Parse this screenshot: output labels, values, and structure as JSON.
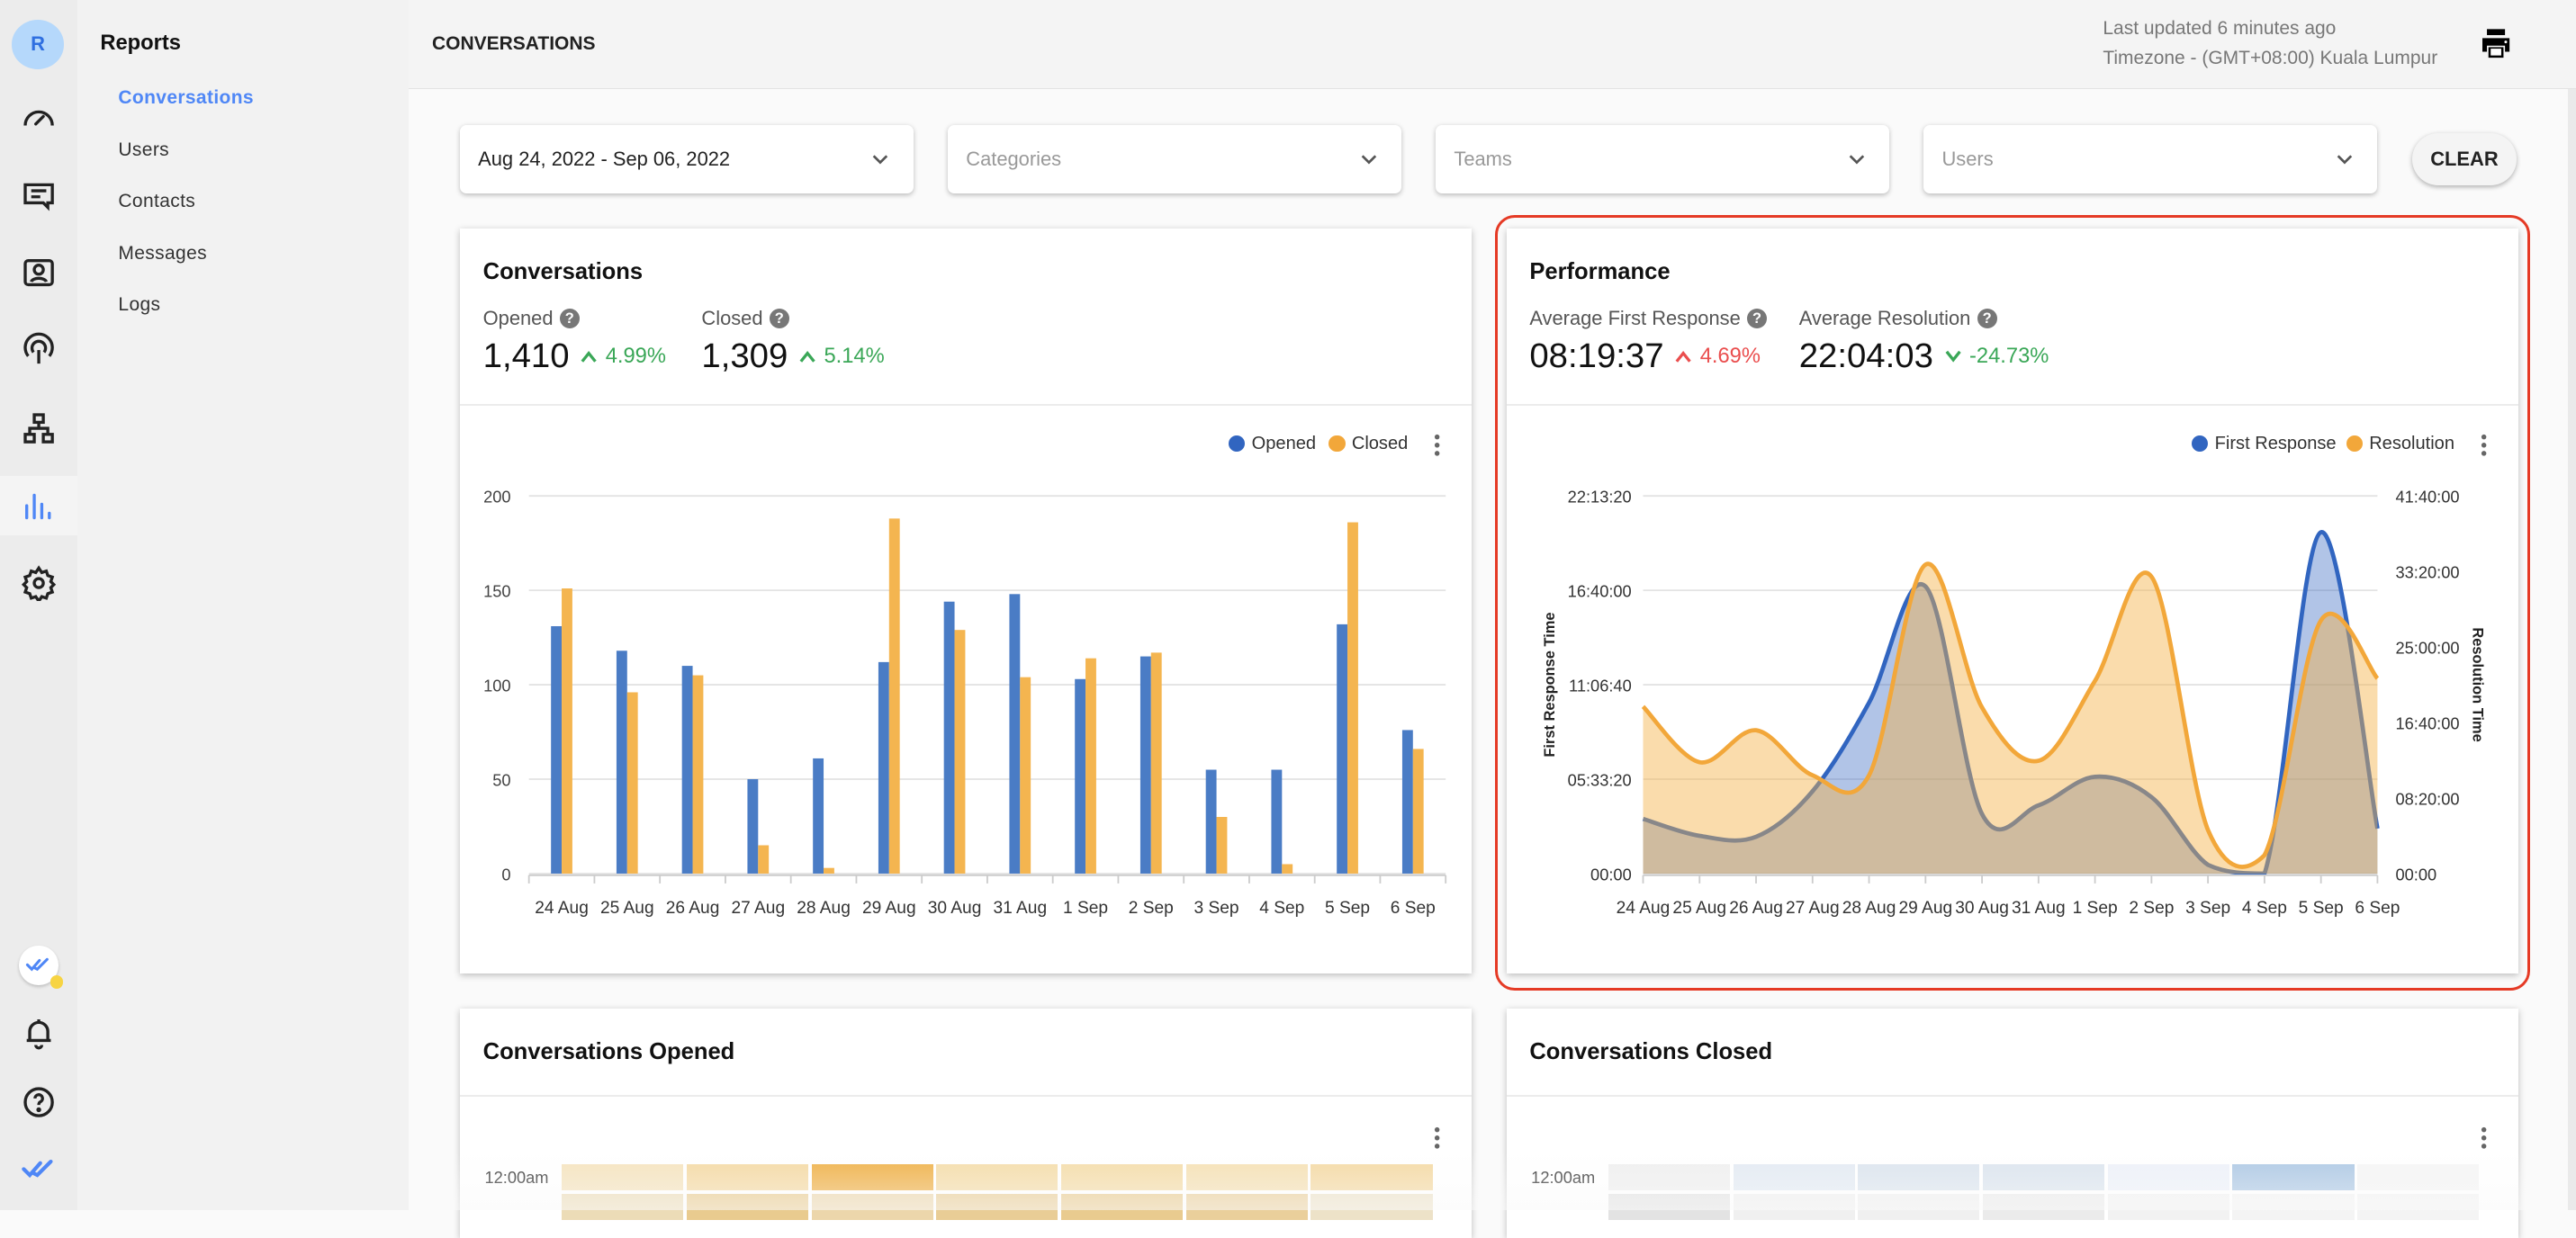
{
  "rail": {
    "avatar_initial": "R",
    "icons": [
      "gauge-icon",
      "chat-icon",
      "contact-icon",
      "broadcast-icon",
      "sitemap-icon",
      "bar-chart-icon",
      "gear-icon"
    ],
    "bottom_icons": [
      "app-badge-icon",
      "bell-icon",
      "help-icon",
      "logo-icon"
    ],
    "active": "bar-chart-icon",
    "accent": "#4f87f6"
  },
  "subnav": {
    "title": "Reports",
    "items": [
      {
        "label": "Conversations",
        "active": true
      },
      {
        "label": "Users"
      },
      {
        "label": "Contacts"
      },
      {
        "label": "Messages"
      },
      {
        "label": "Logs"
      }
    ]
  },
  "header": {
    "title": "CONVERSATIONS",
    "last_updated": "Last updated 6 minutes ago",
    "timezone": "Timezone - (GMT+08:00) Kuala Lumpur",
    "print_icon": "printer-icon"
  },
  "filters": {
    "date_range": "Aug 24, 2022 - Sep 06, 2022",
    "categories_placeholder": "Categories",
    "teams_placeholder": "Teams",
    "users_placeholder": "Users",
    "clear_label": "CLEAR"
  },
  "conversations_card": {
    "title": "Conversations",
    "opened_label": "Opened",
    "opened_value": "1,410",
    "opened_change": "4.99%",
    "closed_label": "Closed",
    "closed_value": "1,309",
    "closed_change": "5.14%",
    "up_color": "#3aa757"
  },
  "performance_card": {
    "title": "Performance",
    "afr_label": "Average First Response",
    "afr_value": "08:19:37",
    "afr_change": "4.69%",
    "afr_color": "#ea4e4e",
    "ar_label": "Average Resolution",
    "ar_value": "22:04:03",
    "ar_change": "-24.73%",
    "ar_color": "#3aa757",
    "highlight_color": "#e53a25"
  },
  "chart_data": [
    {
      "type": "bar",
      "categories": [
        "24 Aug",
        "25 Aug",
        "26 Aug",
        "27 Aug",
        "28 Aug",
        "29 Aug",
        "30 Aug",
        "31 Aug",
        "1 Sep",
        "2 Sep",
        "3 Sep",
        "4 Sep",
        "5 Sep",
        "6 Sep"
      ],
      "series": [
        {
          "name": "Opened",
          "color": "#4a7cc5",
          "values": [
            131,
            118,
            110,
            50,
            61,
            112,
            144,
            148,
            103,
            115,
            55,
            55,
            132,
            76
          ]
        },
        {
          "name": "Closed",
          "color": "#f4b550",
          "values": [
            151,
            96,
            105,
            15,
            3,
            188,
            129,
            104,
            114,
            117,
            30,
            5,
            186,
            66
          ]
        }
      ],
      "yticks": [
        "0",
        "50",
        "100",
        "150",
        "200"
      ],
      "ylim": [
        0,
        200
      ],
      "grid": true,
      "legend": "top-right"
    },
    {
      "type": "area",
      "categories": [
        "24 Aug",
        "25 Aug",
        "26 Aug",
        "27 Aug",
        "28 Aug",
        "29 Aug",
        "30 Aug",
        "31 Aug",
        "1 Sep",
        "2 Sep",
        "3 Sep",
        "4 Sep",
        "5 Sep",
        "6 Sep"
      ],
      "series": [
        {
          "name": "First Response",
          "axis": "left",
          "color": "#3165c0",
          "values": [
            "03:13:10",
            "02:13:20",
            "02:10:00",
            "04:50:40",
            "10:03:20",
            "16:53:40",
            "03:30:20",
            "04:01:00",
            "05:41:50",
            "04:30:00",
            "00:30:50",
            "00:00:00",
            "20:05:00",
            "02:39:00"
          ]
        },
        {
          "name": "Resolution",
          "axis": "right",
          "color": "#f2a73a",
          "values": [
            "18:25:50",
            "12:17:10",
            "15:48:40",
            "10:50:40",
            "10:50:40",
            "34:05:00",
            "18:19:20",
            "12:26:40",
            "21:15:40",
            "32:45:00",
            "04:48:20",
            "02:01:40",
            "27:56:20",
            "21:31:40"
          ]
        }
      ],
      "ylabel_left": "First Response Time",
      "ylabel_right": "Resolution Time",
      "yticks_left": [
        "00:00",
        "05:33:20",
        "11:06:40",
        "16:40:00",
        "22:13:20"
      ],
      "yticks_right": [
        "00:00",
        "08:20:00",
        "16:40:00",
        "25:00:00",
        "33:20:00",
        "41:40:00"
      ],
      "ylim_left": [
        "00:00:00",
        "22:13:20"
      ],
      "ylim_right": [
        "00:00:00",
        "41:40:00"
      ],
      "grid": true,
      "legend": "top-right",
      "smooth": true
    }
  ],
  "opened_heatmap": {
    "title": "Conversations Opened",
    "row_label": "12:00am",
    "rows": [
      [
        "#f5e3bd",
        "#f4d9a3",
        "#efb046",
        "#f4dca8",
        "#f4dca8",
        "#f5e0b3",
        "#f4d9a3"
      ],
      [
        "#ecdcb7",
        "#e9cb8f",
        "#ecd6ab",
        "#e9cd96",
        "#e9cb8f",
        "#eacf9b",
        "#ede2c8"
      ]
    ]
  },
  "closed_heatmap": {
    "title": "Conversations Closed",
    "row_label": "12:00am",
    "rows": [
      [
        "#efefef",
        "#e3eaf3",
        "#dbe4ee",
        "#dbe4ee",
        "#edf1f9",
        "#adc8e4",
        "#f5f5f5"
      ],
      [
        "#e3e3e3",
        "#f0f0f0",
        "#f0f0f0",
        "#ebebeb",
        "#f2f2f2",
        "#f4f4f4",
        "#f4f4f4"
      ]
    ]
  }
}
